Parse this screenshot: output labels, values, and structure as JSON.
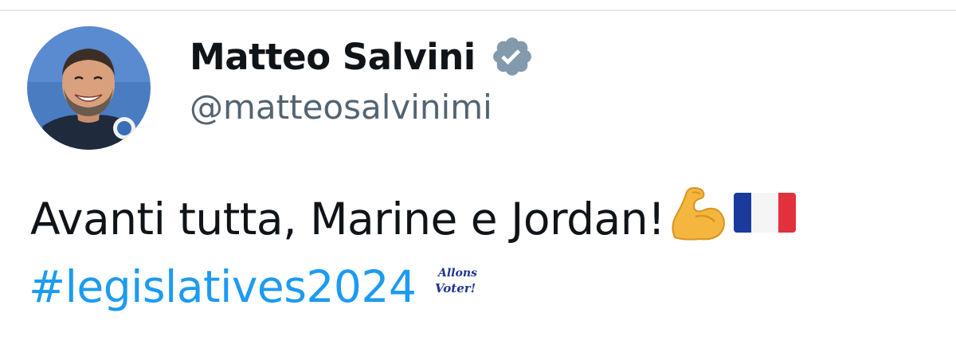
{
  "author": {
    "display_name": "Matteo Salvini",
    "handle": "@matteosalvinimi",
    "verified": true,
    "verified_icon": "verified-badge-icon",
    "verified_color": "#829aab"
  },
  "tweet": {
    "text": "Avanti tutta, Marine e Jordan!",
    "emojis": [
      "flexed-biceps-icon",
      "french-flag-icon"
    ],
    "hashtag": "#legislatives2024",
    "hashtag_color": "#1d9bf0",
    "hashflag_text": [
      "Allons",
      "Voter!"
    ]
  },
  "colors": {
    "text": "#0f1419",
    "secondary_text": "#536471",
    "divider": "#e7e9ea"
  }
}
